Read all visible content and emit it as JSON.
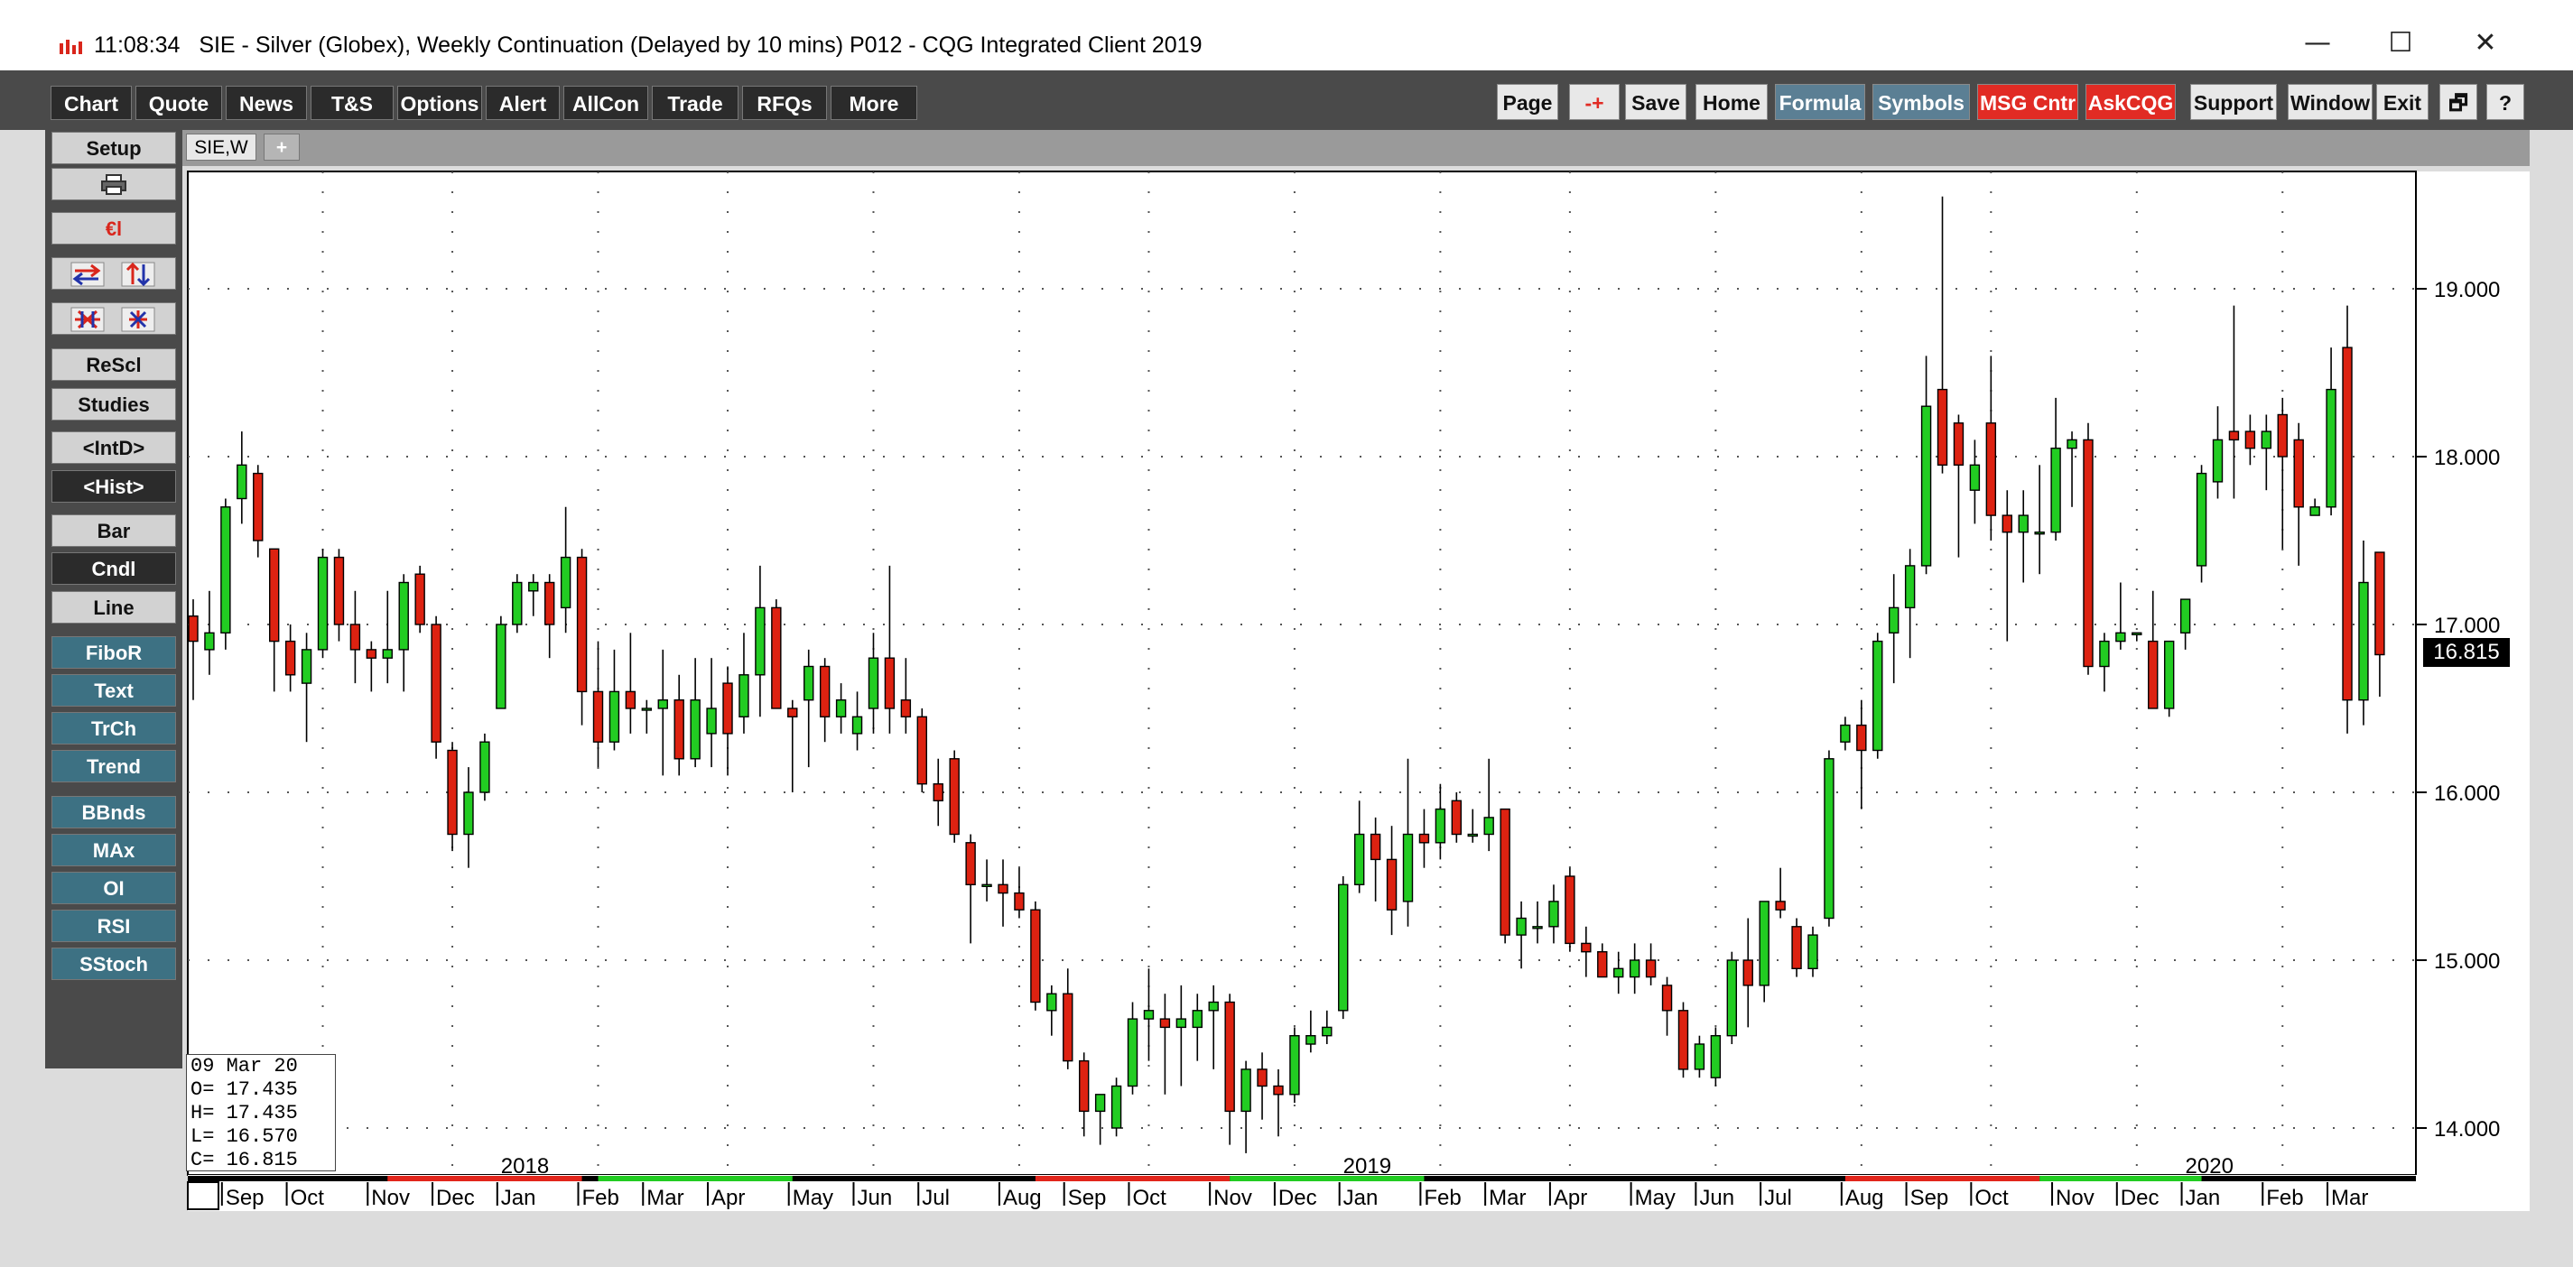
{
  "window": {
    "time": "11:08:34",
    "title": "SIE - Silver (Globex), Weekly Continuation (Delayed by 10 mins)   P012 - CQG Integrated Client 2019",
    "controls": [
      "—",
      "☐",
      "✕"
    ]
  },
  "menu": {
    "left": [
      "Chart",
      "Quote",
      "News",
      "T&S",
      "Options",
      "Alert",
      "AllCon",
      "Trade",
      "RFQs",
      "More"
    ],
    "right": [
      {
        "label": "Page",
        "style": "plain"
      },
      {
        "label": "-+",
        "style": "plain"
      },
      {
        "label": "Save",
        "style": "plain"
      },
      {
        "label": "Home",
        "style": "plain"
      },
      {
        "label": "Formula",
        "style": "blue"
      },
      {
        "label": "Symbols",
        "style": "blue"
      },
      {
        "label": "MSG Cntr",
        "style": "red"
      },
      {
        "label": "AskCQG",
        "style": "red"
      },
      {
        "label": "Support",
        "style": "plain"
      },
      {
        "label": "Window",
        "style": "plain"
      },
      {
        "label": "Exit",
        "style": "plain"
      },
      {
        "label": "🗗",
        "style": "plain"
      },
      {
        "label": "?",
        "style": "plain"
      }
    ]
  },
  "toolbar": {
    "items": [
      {
        "label": "Setup",
        "style": "grey",
        "icon": ""
      },
      {
        "label": "",
        "style": "grey",
        "icon": "printer-icon"
      },
      {
        "label": "€l",
        "style": "grey",
        "icon": ""
      },
      {
        "label": "",
        "style": "grey",
        "icon": "swap-icon"
      },
      {
        "label": "",
        "style": "grey",
        "icon": "grid-icon"
      },
      {
        "label": "ReScl",
        "style": "grey",
        "icon": ""
      },
      {
        "label": "Studies",
        "style": "grey",
        "icon": ""
      },
      {
        "label": "<IntD>",
        "style": "grey",
        "icon": ""
      },
      {
        "label": "<Hist>",
        "style": "dark",
        "icon": ""
      },
      {
        "label": "Bar",
        "style": "grey",
        "icon": ""
      },
      {
        "label": "Cndl",
        "style": "dark",
        "icon": ""
      },
      {
        "label": "Line",
        "style": "grey",
        "icon": ""
      },
      {
        "label": "FiboR",
        "style": "teal",
        "icon": ""
      },
      {
        "label": "Text",
        "style": "teal",
        "icon": ""
      },
      {
        "label": "TrCh",
        "style": "teal",
        "icon": ""
      },
      {
        "label": "Trend",
        "style": "teal",
        "icon": ""
      },
      {
        "label": "BBnds",
        "style": "teal",
        "icon": ""
      },
      {
        "label": "MAx",
        "style": "teal",
        "icon": ""
      },
      {
        "label": "OI",
        "style": "teal",
        "icon": ""
      },
      {
        "label": "RSI",
        "style": "teal",
        "icon": ""
      },
      {
        "label": "SStoch",
        "style": "teal",
        "icon": ""
      }
    ]
  },
  "tabs": [
    {
      "label": "SIE,W"
    },
    {
      "label": "+"
    }
  ],
  "info_box": {
    "date": "09 Mar 20",
    "O": "17.435",
    "H": "17.435",
    "L": "16.570",
    "C": "16.815"
  },
  "last_price": "16.815",
  "colors": {
    "up": "#22cc22",
    "down": "#dd2211",
    "grid": "#555555"
  },
  "chart_data": {
    "type": "candlestick",
    "symbol": "SIE",
    "interval": "Weekly",
    "ylim": [
      13.7,
      19.7
    ],
    "y_ticks": [
      "19.000",
      "18.000",
      "17.000",
      "16.000",
      "15.000",
      "14.000"
    ],
    "y_tick_values": [
      19,
      18,
      17,
      16,
      15,
      14
    ],
    "x_month_labels": [
      "Sep",
      "Oct",
      "Nov",
      "Dec",
      "Jan",
      "Feb",
      "Mar",
      "Apr",
      "May",
      "Jun",
      "Jul",
      "Aug",
      "Sep",
      "Oct",
      "Nov",
      "Dec",
      "Jan",
      "Feb",
      "Mar",
      "Apr",
      "May",
      "Jun",
      "Jul",
      "Aug",
      "Sep",
      "Oct",
      "Nov",
      "Dec",
      "Jan",
      "Feb",
      "Mar"
    ],
    "x_month_weeks": [
      3,
      7,
      12,
      16,
      20,
      25,
      29,
      33,
      38,
      42,
      46,
      51,
      55,
      59,
      64,
      68,
      72,
      77,
      81,
      85,
      90,
      94,
      98,
      103,
      107,
      111,
      116,
      120,
      124,
      129,
      133
    ],
    "year_labels": [
      {
        "label": "2018",
        "week": 20
      },
      {
        "label": "2019",
        "week": 72
      },
      {
        "label": "2020",
        "week": 124
      }
    ],
    "grid": true,
    "candles": [
      [
        17.05,
        17.15,
        16.55,
        16.9
      ],
      [
        16.85,
        17.2,
        16.7,
        16.95
      ],
      [
        16.95,
        17.75,
        16.85,
        17.7
      ],
      [
        17.75,
        18.15,
        17.6,
        17.95
      ],
      [
        17.9,
        17.95,
        17.4,
        17.5
      ],
      [
        17.45,
        17.45,
        16.6,
        16.9
      ],
      [
        16.9,
        17.0,
        16.6,
        16.7
      ],
      [
        16.65,
        16.95,
        16.3,
        16.85
      ],
      [
        16.85,
        17.45,
        16.8,
        17.4
      ],
      [
        17.4,
        17.45,
        16.9,
        17.0
      ],
      [
        17.0,
        17.2,
        16.65,
        16.85
      ],
      [
        16.85,
        16.9,
        16.6,
        16.8
      ],
      [
        16.8,
        17.2,
        16.65,
        16.85
      ],
      [
        16.85,
        17.3,
        16.6,
        17.25
      ],
      [
        17.3,
        17.35,
        16.95,
        17.0
      ],
      [
        17.0,
        17.05,
        16.2,
        16.3
      ],
      [
        16.25,
        16.3,
        15.65,
        15.75
      ],
      [
        15.75,
        16.15,
        15.55,
        16.0
      ],
      [
        16.0,
        16.35,
        15.95,
        16.3
      ],
      [
        16.5,
        17.05,
        16.5,
        17.0
      ],
      [
        17.0,
        17.3,
        16.95,
        17.25
      ],
      [
        17.2,
        17.3,
        17.05,
        17.25
      ],
      [
        17.25,
        17.3,
        16.8,
        17.0
      ],
      [
        17.1,
        17.7,
        16.95,
        17.4
      ],
      [
        17.4,
        17.45,
        16.4,
        16.6
      ],
      [
        16.6,
        16.9,
        16.15,
        16.3
      ],
      [
        16.3,
        16.85,
        16.25,
        16.6
      ],
      [
        16.6,
        16.95,
        16.35,
        16.5
      ],
      [
        16.5,
        16.55,
        16.35,
        16.5
      ],
      [
        16.5,
        16.85,
        16.1,
        16.55
      ],
      [
        16.55,
        16.7,
        16.1,
        16.2
      ],
      [
        16.2,
        16.8,
        16.15,
        16.55
      ],
      [
        16.35,
        16.8,
        16.15,
        16.5
      ],
      [
        16.65,
        16.75,
        16.1,
        16.35
      ],
      [
        16.45,
        16.95,
        16.35,
        16.7
      ],
      [
        16.7,
        17.35,
        16.45,
        17.1
      ],
      [
        17.1,
        17.15,
        16.5,
        16.5
      ],
      [
        16.5,
        16.55,
        16.0,
        16.45
      ],
      [
        16.55,
        16.85,
        16.15,
        16.75
      ],
      [
        16.75,
        16.8,
        16.3,
        16.45
      ],
      [
        16.45,
        16.65,
        16.35,
        16.55
      ],
      [
        16.35,
        16.6,
        16.25,
        16.45
      ],
      [
        16.5,
        16.95,
        16.35,
        16.8
      ],
      [
        16.8,
        17.35,
        16.35,
        16.5
      ],
      [
        16.55,
        16.8,
        16.35,
        16.45
      ],
      [
        16.45,
        16.5,
        16.0,
        16.05
      ],
      [
        16.05,
        16.2,
        15.8,
        15.95
      ],
      [
        16.2,
        16.25,
        15.7,
        15.75
      ],
      [
        15.7,
        15.75,
        15.1,
        15.45
      ],
      [
        15.45,
        15.6,
        15.35,
        15.45
      ],
      [
        15.45,
        15.6,
        15.2,
        15.4
      ],
      [
        15.4,
        15.55,
        15.25,
        15.3
      ],
      [
        15.3,
        15.35,
        14.7,
        14.75
      ],
      [
        14.7,
        14.85,
        14.55,
        14.8
      ],
      [
        14.8,
        14.95,
        14.35,
        14.4
      ],
      [
        14.4,
        14.45,
        13.95,
        14.1
      ],
      [
        14.1,
        14.2,
        13.9,
        14.2
      ],
      [
        14.0,
        14.3,
        13.95,
        14.25
      ],
      [
        14.25,
        14.75,
        14.2,
        14.65
      ],
      [
        14.65,
        14.95,
        14.4,
        14.7
      ],
      [
        14.65,
        14.8,
        14.2,
        14.6
      ],
      [
        14.6,
        14.85,
        14.25,
        14.65
      ],
      [
        14.6,
        14.8,
        14.4,
        14.7
      ],
      [
        14.7,
        14.85,
        14.35,
        14.75
      ],
      [
        14.75,
        14.8,
        13.9,
        14.1
      ],
      [
        14.1,
        14.4,
        13.85,
        14.35
      ],
      [
        14.35,
        14.45,
        14.05,
        14.25
      ],
      [
        14.25,
        14.35,
        13.95,
        14.2
      ],
      [
        14.2,
        14.6,
        14.15,
        14.55
      ],
      [
        14.5,
        14.7,
        14.45,
        14.55
      ],
      [
        14.55,
        14.7,
        14.5,
        14.6
      ],
      [
        14.7,
        15.5,
        14.65,
        15.45
      ],
      [
        15.45,
        15.95,
        15.4,
        15.75
      ],
      [
        15.75,
        15.85,
        15.35,
        15.6
      ],
      [
        15.6,
        15.8,
        15.15,
        15.3
      ],
      [
        15.35,
        16.2,
        15.2,
        15.75
      ],
      [
        15.75,
        15.9,
        15.55,
        15.7
      ],
      [
        15.7,
        16.05,
        15.6,
        15.9
      ],
      [
        15.95,
        16.0,
        15.7,
        15.75
      ],
      [
        15.75,
        15.9,
        15.7,
        15.75
      ],
      [
        15.75,
        16.2,
        15.65,
        15.85
      ],
      [
        15.9,
        15.9,
        15.1,
        15.15
      ],
      [
        15.15,
        15.35,
        14.95,
        15.25
      ],
      [
        15.2,
        15.35,
        15.1,
        15.2
      ],
      [
        15.2,
        15.45,
        15.1,
        15.35
      ],
      [
        15.5,
        15.55,
        15.05,
        15.1
      ],
      [
        15.1,
        15.2,
        14.9,
        15.05
      ],
      [
        15.05,
        15.1,
        14.9,
        14.9
      ],
      [
        14.9,
        15.05,
        14.8,
        14.95
      ],
      [
        14.9,
        15.1,
        14.8,
        15.0
      ],
      [
        15.0,
        15.1,
        14.85,
        14.9
      ],
      [
        14.85,
        14.9,
        14.55,
        14.7
      ],
      [
        14.7,
        14.75,
        14.3,
        14.35
      ],
      [
        14.35,
        14.55,
        14.3,
        14.5
      ],
      [
        14.3,
        14.6,
        14.25,
        14.55
      ],
      [
        14.55,
        15.05,
        14.5,
        15.0
      ],
      [
        15.0,
        15.25,
        14.6,
        14.85
      ],
      [
        14.85,
        15.35,
        14.75,
        15.35
      ],
      [
        15.35,
        15.55,
        15.25,
        15.3
      ],
      [
        15.2,
        15.25,
        14.9,
        14.95
      ],
      [
        14.95,
        15.2,
        14.9,
        15.15
      ],
      [
        15.25,
        16.25,
        15.2,
        16.2
      ],
      [
        16.3,
        16.45,
        16.25,
        16.4
      ],
      [
        16.4,
        16.55,
        15.9,
        16.25
      ],
      [
        16.25,
        16.95,
        16.2,
        16.9
      ],
      [
        16.95,
        17.3,
        16.65,
        17.1
      ],
      [
        17.1,
        17.45,
        16.8,
        17.35
      ],
      [
        17.35,
        18.6,
        17.3,
        18.3
      ],
      [
        18.4,
        19.55,
        17.9,
        17.95
      ],
      [
        18.2,
        18.25,
        17.4,
        17.95
      ],
      [
        17.8,
        18.1,
        17.6,
        17.95
      ],
      [
        18.2,
        18.6,
        17.5,
        17.65
      ],
      [
        17.65,
        17.8,
        16.9,
        17.55
      ],
      [
        17.55,
        17.8,
        17.25,
        17.65
      ],
      [
        17.55,
        17.95,
        17.3,
        17.55
      ],
      [
        17.55,
        18.35,
        17.5,
        18.05
      ],
      [
        18.05,
        18.15,
        17.7,
        18.1
      ],
      [
        18.1,
        18.2,
        16.7,
        16.75
      ],
      [
        16.75,
        16.95,
        16.6,
        16.9
      ],
      [
        16.9,
        17.25,
        16.85,
        16.95
      ],
      [
        16.95,
        16.95,
        16.9,
        16.95
      ],
      [
        16.9,
        17.2,
        16.5,
        16.5
      ],
      [
        16.5,
        16.9,
        16.45,
        16.9
      ],
      [
        16.95,
        17.15,
        16.85,
        17.15
      ],
      [
        17.35,
        17.95,
        17.25,
        17.9
      ],
      [
        17.85,
        18.3,
        17.75,
        18.1
      ],
      [
        18.15,
        18.9,
        17.75,
        18.1
      ],
      [
        18.15,
        18.25,
        17.95,
        18.05
      ],
      [
        18.05,
        18.25,
        17.8,
        18.15
      ],
      [
        18.25,
        18.35,
        17.45,
        18.0
      ],
      [
        18.1,
        18.2,
        17.35,
        17.7
      ],
      [
        17.65,
        17.75,
        17.65,
        17.7
      ],
      [
        17.7,
        18.65,
        17.65,
        18.4
      ],
      [
        18.65,
        18.9,
        16.35,
        16.55
      ],
      [
        16.55,
        17.5,
        16.4,
        17.25
      ],
      [
        17.43,
        17.43,
        16.57,
        16.82
      ]
    ]
  }
}
